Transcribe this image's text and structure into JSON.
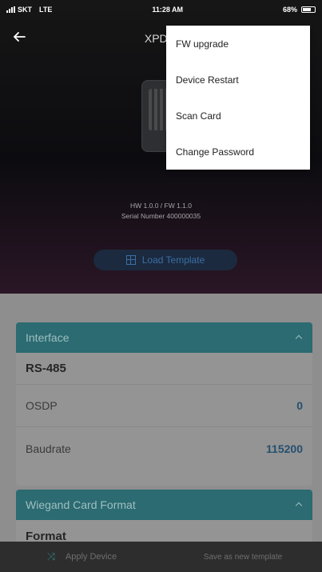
{
  "status_bar": {
    "carrier": "SKT",
    "network": "LTE",
    "time": "11:28 AM",
    "battery": "68%"
  },
  "header": {
    "title": "XPD2-",
    "hw_fw": "HW 1.0.0 / FW 1.1.0",
    "serial": "Serial Number 400000035",
    "load_template_label": "Load Template"
  },
  "menu": {
    "items": [
      {
        "label": "FW upgrade"
      },
      {
        "label": "Device Restart"
      },
      {
        "label": "Scan Card"
      },
      {
        "label": "Change Password"
      }
    ]
  },
  "interface_card": {
    "title": "Interface",
    "type": "RS-485",
    "rows": [
      {
        "label": "OSDP",
        "value": "0"
      },
      {
        "label": "Baudrate",
        "value": "115200"
      }
    ]
  },
  "wiegand_card": {
    "title": "Wiegand Card Format",
    "format_label": "Format"
  },
  "bottom_bar": {
    "apply_label": "Apply Device",
    "save_label": "Save as new template"
  },
  "colors": {
    "accent_teal": "#2b6b71",
    "value_blue": "#24506f",
    "menu_bg": "#ffffff"
  },
  "icons": [
    "back-arrow-icon",
    "template-icon",
    "chevron-up-icon",
    "shuffle-icon",
    "battery-icon",
    "signal-icon"
  ]
}
